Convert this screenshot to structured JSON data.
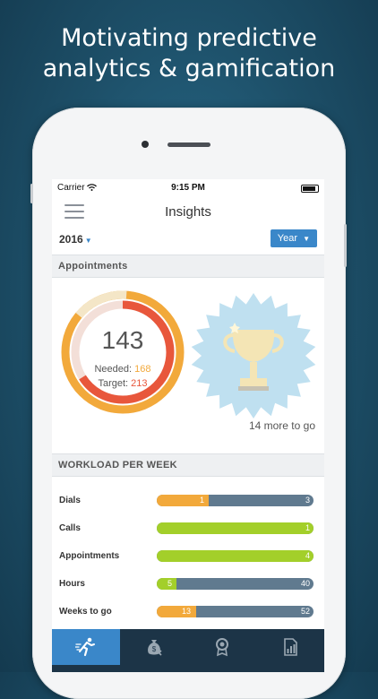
{
  "headline": {
    "line1": "Motivating predictive",
    "line2": "analytics & gamification"
  },
  "status_bar": {
    "carrier": "Carrier",
    "time": "9:15 PM"
  },
  "nav": {
    "title": "Insights",
    "menu_icon": "hamburger-menu-icon"
  },
  "filters": {
    "year": "2016",
    "period": "Year"
  },
  "appointments": {
    "section_title": "Appointments",
    "count": "143",
    "needed_label": "Needed:",
    "needed_value": "168",
    "target_label": "Target:",
    "target_value": "213",
    "more_to_go": "14 more to go",
    "badge_icon": "trophy-icon",
    "progress": {
      "count": 143,
      "needed": 168,
      "target": 213
    }
  },
  "workload": {
    "section_title": "WORKLOAD PER WEEK",
    "rows": [
      {
        "label": "Dials",
        "value1": "1",
        "value2": "3",
        "fill_fraction": 0.33,
        "fill_color": "#f2a93b"
      },
      {
        "label": "Calls",
        "value1": "",
        "value2": "1",
        "fill_fraction": 1.0,
        "fill_color": "#a3cf2a"
      },
      {
        "label": "Appointments",
        "value1": "",
        "value2": "4",
        "fill_fraction": 1.0,
        "fill_color": "#a3cf2a"
      },
      {
        "label": "Hours",
        "value1": "5",
        "value2": "40",
        "fill_fraction": 0.125,
        "fill_color": "#a3cf2a"
      },
      {
        "label": "Weeks to go",
        "value1": "13",
        "value2": "52",
        "fill_fraction": 0.25,
        "fill_color": "#f2a93b"
      }
    ]
  },
  "tabbar": {
    "tabs": [
      {
        "icon": "running-person-icon",
        "active": true
      },
      {
        "icon": "money-bag-icon",
        "active": false
      },
      {
        "icon": "award-medal-icon",
        "active": false
      },
      {
        "icon": "report-chart-icon",
        "active": false
      }
    ]
  },
  "colors": {
    "accent_blue": "#3a87c9",
    "orange": "#f2a93b",
    "red": "#e8573c",
    "green": "#a3cf2a",
    "slate": "#607a8f",
    "tabbar": "#1c3447"
  }
}
